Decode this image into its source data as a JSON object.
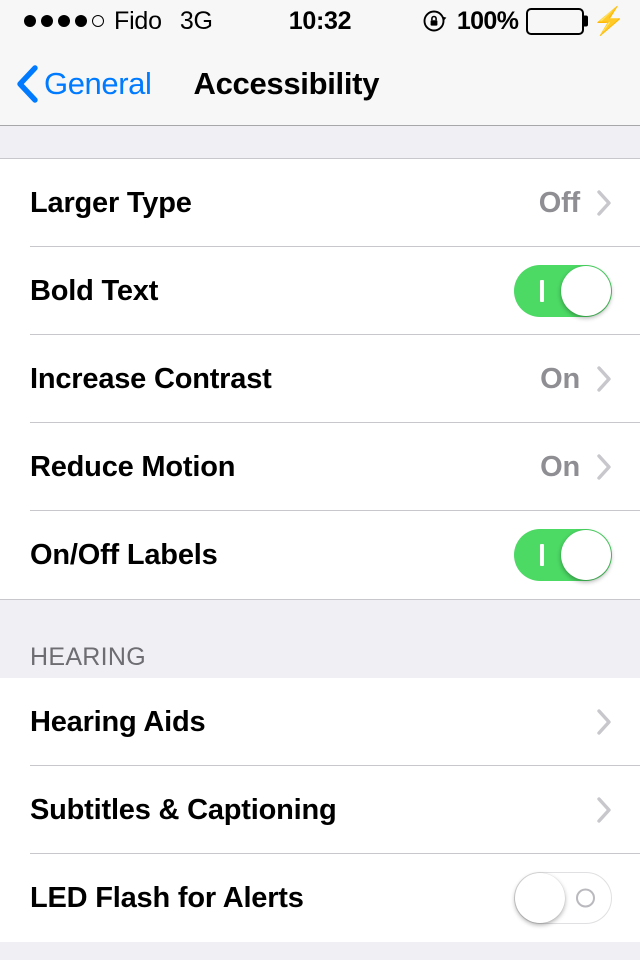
{
  "status_bar": {
    "signal_dots_filled": 4,
    "signal_dots_total": 5,
    "carrier": "Fido",
    "network_type": "3G",
    "time": "10:32",
    "rotation_lock_icon": "rotation-lock-icon",
    "battery_percent": "100%",
    "battery_level": 100,
    "battery_color": "#4CD964",
    "charging_icon": "lightning-bolt-icon"
  },
  "nav_bar": {
    "back_icon": "chevron-left-icon",
    "back_label": "General",
    "title": "Accessibility",
    "accent_color": "#007AFF"
  },
  "sections": [
    {
      "header": "",
      "rows": [
        {
          "label": "Larger Type",
          "value": "Off",
          "control": "chevron",
          "chevron_icon": "chevron-right-icon"
        },
        {
          "label": "Bold Text",
          "value": "",
          "control": "switch",
          "switch_state": "on",
          "switch_label": "I"
        },
        {
          "label": "Increase Contrast",
          "value": "On",
          "control": "chevron",
          "chevron_icon": "chevron-right-icon"
        },
        {
          "label": "Reduce Motion",
          "value": "On",
          "control": "chevron",
          "chevron_icon": "chevron-right-icon"
        },
        {
          "label": "On/Off Labels",
          "value": "",
          "control": "switch",
          "switch_state": "on",
          "switch_label": "I"
        }
      ]
    },
    {
      "header": "HEARING",
      "rows": [
        {
          "label": "Hearing Aids",
          "value": "",
          "control": "chevron",
          "chevron_icon": "chevron-right-icon"
        },
        {
          "label": "Subtitles & Captioning",
          "value": "",
          "control": "chevron",
          "chevron_icon": "chevron-right-icon"
        },
        {
          "label": "LED Flash for Alerts",
          "value": "",
          "control": "switch",
          "switch_state": "off",
          "switch_label": "O"
        }
      ]
    }
  ],
  "colors": {
    "switch_on_track": "#4CD964",
    "separator": "#C8C7CC",
    "group_background": "#EFEFF4",
    "secondary_text": "#8E8E93",
    "header_text": "#6D6D72"
  }
}
